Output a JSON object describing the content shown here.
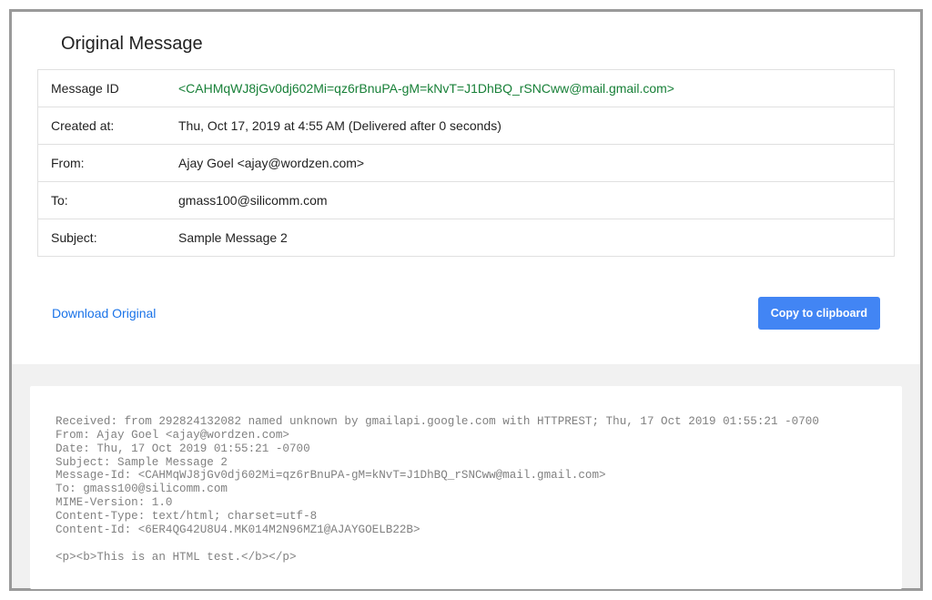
{
  "header": {
    "title": "Original Message"
  },
  "fields": {
    "message_id": {
      "label": "Message ID",
      "value": "<CAHMqWJ8jGv0dj602Mi=qz6rBnuPA-gM=kNvT=J1DhBQ_rSNCww@mail.gmail.com>"
    },
    "created_at": {
      "label": "Created at:",
      "value": "Thu, Oct 17, 2019 at 4:55 AM (Delivered after 0 seconds)"
    },
    "from": {
      "label": "From:",
      "value": "Ajay Goel <ajay@wordzen.com>"
    },
    "to": {
      "label": "To:",
      "value": "gmass100@silicomm.com"
    },
    "subject": {
      "label": "Subject:",
      "value": "Sample Message 2"
    }
  },
  "actions": {
    "download_label": "Download Original",
    "copy_label": "Copy to clipboard"
  },
  "raw": "Received: from 292824132082 named unknown by gmailapi.google.com with HTTPREST; Thu, 17 Oct 2019 01:55:21 -0700\nFrom: Ajay Goel <ajay@wordzen.com>\nDate: Thu, 17 Oct 2019 01:55:21 -0700\nSubject: Sample Message 2\nMessage-Id: <CAHMqWJ8jGv0dj602Mi=qz6rBnuPA-gM=kNvT=J1DhBQ_rSNCww@mail.gmail.com>\nTo: gmass100@silicomm.com\nMIME-Version: 1.0\nContent-Type: text/html; charset=utf-8\nContent-Id: <6ER4QG42U8U4.MK014M2N96MZ1@AJAYGOELB22B>\n\n<p><b>This is an HTML test.</b></p>"
}
